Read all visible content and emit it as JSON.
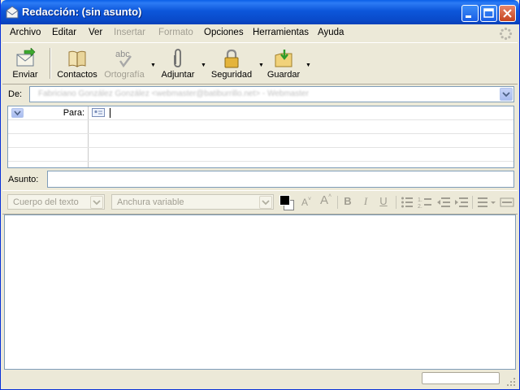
{
  "window": {
    "title": "Redacción: (sin asunto)"
  },
  "menu": [
    {
      "label": "Archivo",
      "enabled": true
    },
    {
      "label": "Editar",
      "enabled": true
    },
    {
      "label": "Ver",
      "enabled": true
    },
    {
      "label": "Insertar",
      "enabled": false
    },
    {
      "label": "Formato",
      "enabled": false
    },
    {
      "label": "Opciones",
      "enabled": true
    },
    {
      "label": "Herramientas",
      "enabled": true
    },
    {
      "label": "Ayuda",
      "enabled": true
    }
  ],
  "toolbar": {
    "send": "Enviar",
    "contacts": "Contactos",
    "spelling": "Ortografía",
    "spelling_icon_text": "abc",
    "attach": "Adjuntar",
    "security": "Seguridad",
    "save": "Guardar"
  },
  "from": {
    "label": "De:",
    "value": "Fabriciano González González <webmaster@batiburrillo.net>   - Webmaster"
  },
  "recipients": {
    "type_label": "Para:"
  },
  "subject": {
    "label": "Asunto:",
    "value": ""
  },
  "format": {
    "paragraph_style": "Cuerpo del texto",
    "font": "Anchura variable",
    "text_color": "#000000",
    "bg_color": "#FFFFFF"
  },
  "colors": {
    "title_bar": "#0A4BCB",
    "chrome": "#ECE9D8",
    "field_border": "#7F9DB9"
  },
  "icons": [
    "mail-icon",
    "minimize-icon",
    "maximize-icon",
    "close-icon",
    "throbber-icon",
    "send-icon",
    "contacts-icon",
    "spelling-icon",
    "attach-icon",
    "lock-icon",
    "save-icon",
    "dropdown-arrow-icon",
    "address-card-icon"
  ]
}
